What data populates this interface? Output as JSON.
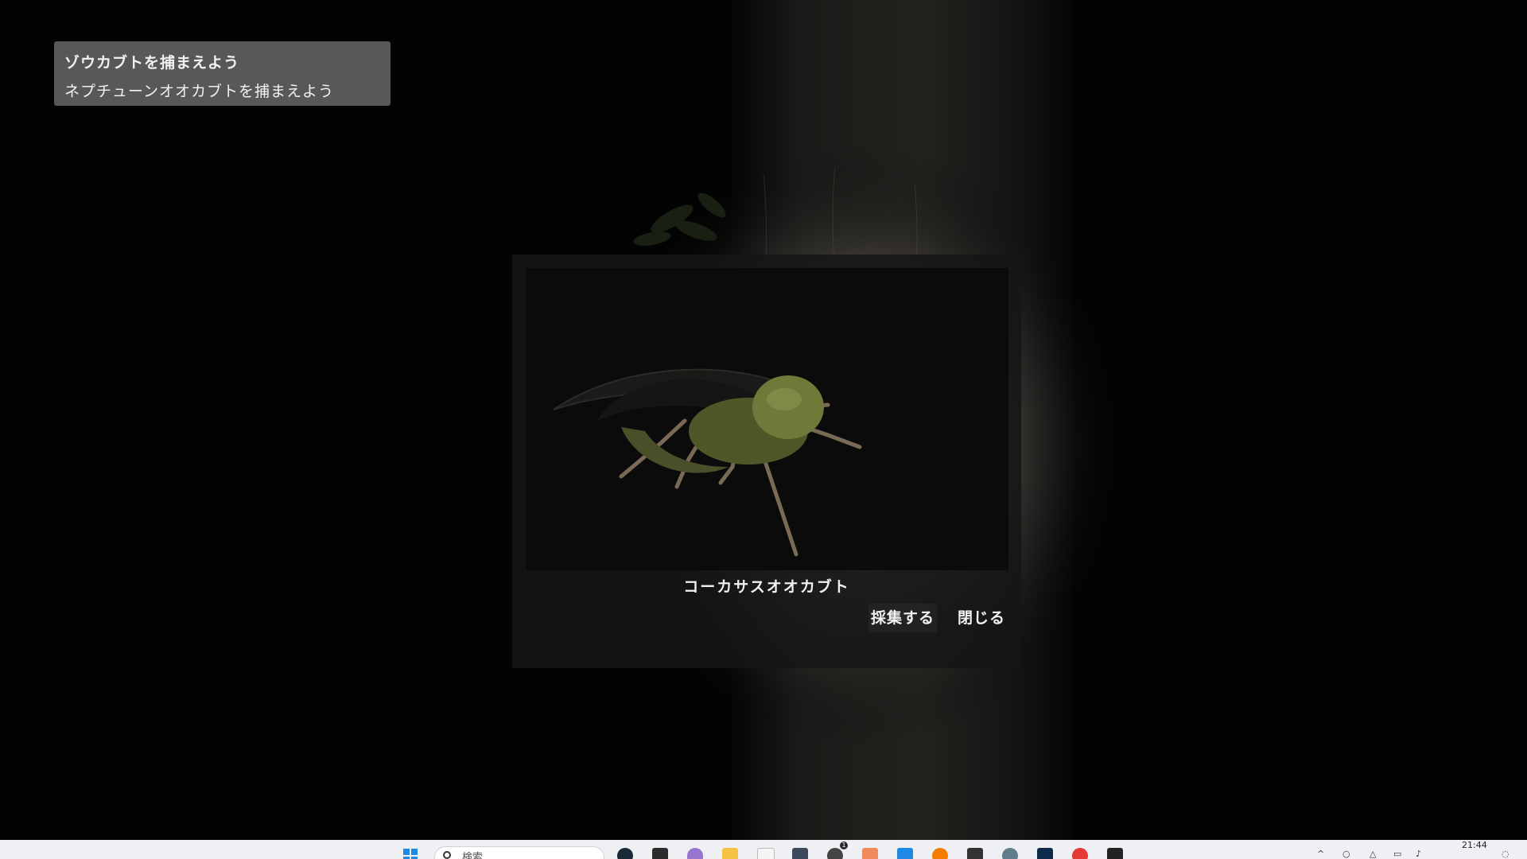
{
  "quests": {
    "items": [
      {
        "label": "ゾウカブトを捕まえよう"
      },
      {
        "label": "ネプチューンオオカブトを捕まえよう"
      }
    ]
  },
  "dialog": {
    "beetle_name": "コーカサスオオカブト",
    "collect_label": "採集する",
    "close_label": "閉じる"
  },
  "taskbar": {
    "search_placeholder": "検索",
    "clock": "21:44",
    "notification_count": "1",
    "pinned_apps": [
      "start-icon",
      "steam-icon",
      "epic-games-icon",
      "app-icon",
      "file-explorer-icon",
      "store-icon",
      "capture-icon",
      "unity-icon",
      "app-icon",
      "vscode-icon",
      "blender-icon",
      "terminal-icon",
      "settings-icon",
      "photoshop-icon",
      "chrome-icon",
      "app-icon"
    ]
  },
  "colors": {
    "background": "#030303",
    "panel": "#8c8c8c",
    "dialog": "#161616",
    "text": "#f2f2f2",
    "beetle": "#6f7a3a"
  }
}
